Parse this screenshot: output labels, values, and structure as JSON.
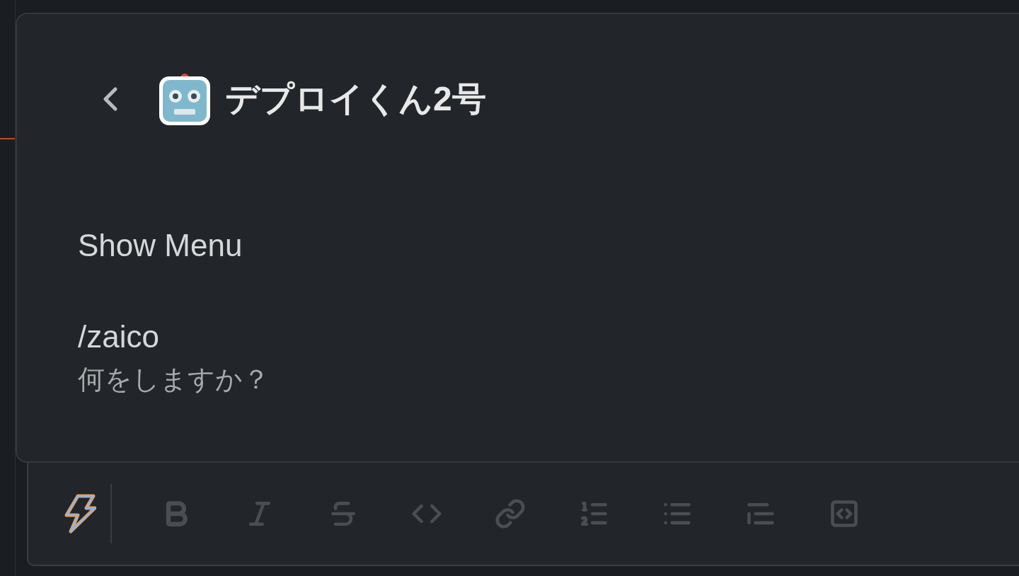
{
  "header": {
    "title": "デプロイくん2号"
  },
  "messages": [
    {
      "kind": "text",
      "text": "Show Menu"
    },
    {
      "kind": "command",
      "command": "/zaico",
      "prompt": "何をしますか？"
    }
  ],
  "toolbar": [
    {
      "kind": "bold",
      "disabled": true
    },
    {
      "kind": "italic",
      "disabled": true
    },
    {
      "kind": "strike",
      "disabled": true
    },
    {
      "kind": "code",
      "disabled": true
    },
    {
      "kind": "link",
      "disabled": true
    },
    {
      "kind": "ordered",
      "disabled": true
    },
    {
      "kind": "bullets",
      "disabled": true
    },
    {
      "kind": "quote",
      "disabled": true
    },
    {
      "kind": "codeblock",
      "disabled": true
    }
  ]
}
